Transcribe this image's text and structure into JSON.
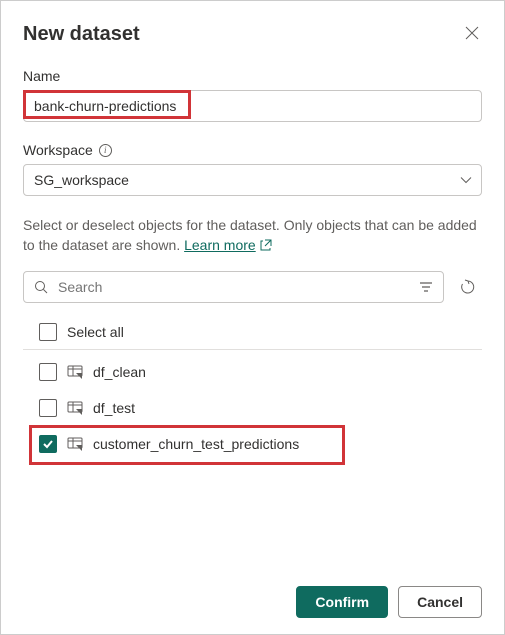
{
  "dialog": {
    "title": "New dataset"
  },
  "fields": {
    "name_label": "Name",
    "name_value": "bank-churn-predictions",
    "workspace_label": "Workspace",
    "workspace_value": "SG_workspace"
  },
  "description": {
    "text": "Select or deselect objects for the dataset. Only objects that can be added to the dataset are shown. ",
    "learn_more": "Learn more "
  },
  "search": {
    "placeholder": "Search"
  },
  "select_all": {
    "label": "Select all",
    "checked": false
  },
  "objects": [
    {
      "name": "df_clean",
      "checked": false,
      "highlighted": false
    },
    {
      "name": "df_test",
      "checked": false,
      "highlighted": false
    },
    {
      "name": "customer_churn_test_predictions",
      "checked": true,
      "highlighted": true
    }
  ],
  "buttons": {
    "confirm": "Confirm",
    "cancel": "Cancel"
  }
}
